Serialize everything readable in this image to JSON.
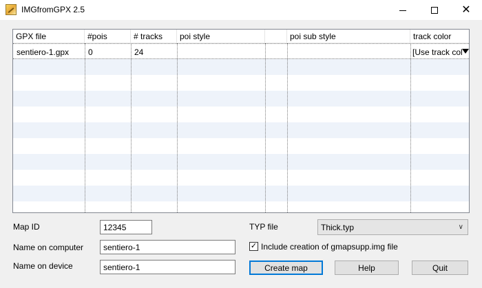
{
  "window": {
    "title": "IMGfromGPX 2.5",
    "icon": "app-icon"
  },
  "grid": {
    "columns": [
      "GPX file",
      "#pois",
      "# tracks",
      "poi style",
      "",
      "poi sub style",
      "track color"
    ],
    "rows": [
      {
        "gpx_file": "sentiero-1.gpx",
        "pois": "0",
        "tracks": "24",
        "poi_style": "",
        "extra": "",
        "poi_sub_style": "",
        "track_color": "[Use track col"
      }
    ],
    "alt_row_color": "#eef3fa"
  },
  "form": {
    "map_id_label": "Map ID",
    "map_id_value": "12345",
    "name_computer_label": "Name on computer",
    "name_computer_value": "sentiero-1",
    "name_device_label": "Name on device",
    "name_device_value": "sentiero-1",
    "typ_file_label": "TYP file",
    "typ_file_value": "Thick.typ",
    "include_label": "Include creation of gmapsupp.img file",
    "include_checked": true
  },
  "buttons": {
    "create_map": "Create map",
    "help": "Help",
    "quit": "Quit"
  },
  "colors": {
    "accent": "#0078d7",
    "grid_border": "#828790"
  }
}
